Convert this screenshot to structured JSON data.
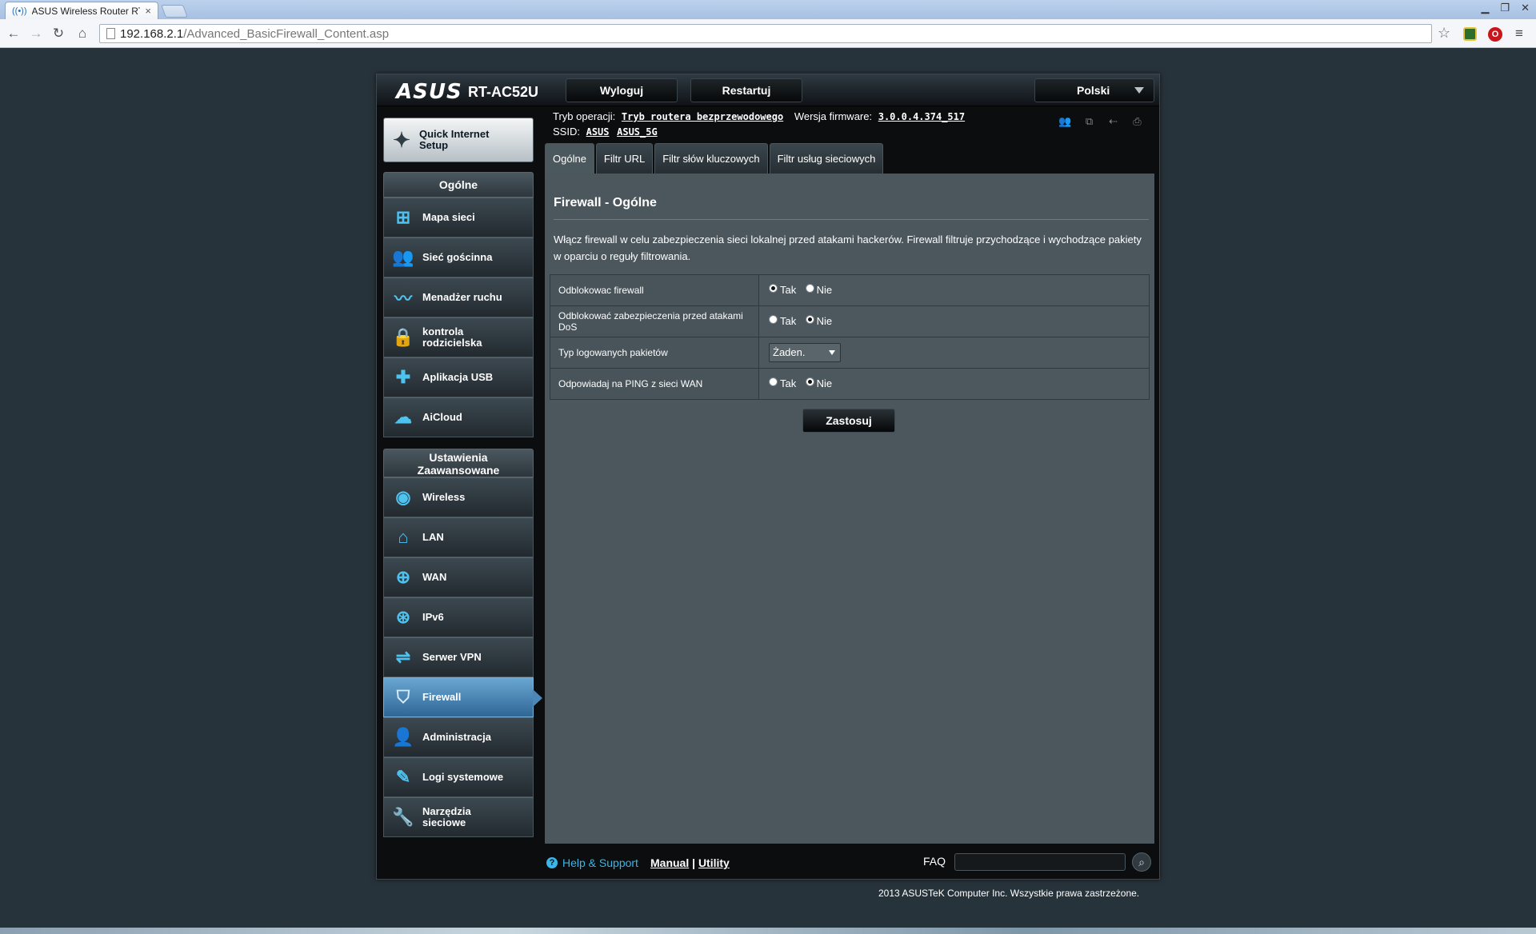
{
  "browser": {
    "tab_title": "ASUS Wireless Router RT-",
    "tab_close": "×",
    "url_host": "192.168.2.1",
    "url_path": "/Advanced_BasicFirewall_Content.asp"
  },
  "header": {
    "logo": "ASUS",
    "model": "RT-AC52U",
    "logout_label": "Wyloguj",
    "restart_label": "Restartuj",
    "language": "Polski"
  },
  "status": {
    "mode_label": "Tryb operacji:",
    "mode_value": "Tryb routera bezprzewodowego",
    "firmware_label": "Wersja firmware:",
    "firmware_value": "3.0.0.4.374_517",
    "ssid_label": "SSID:",
    "ssid_1": "ASUS",
    "ssid_2": "ASUS_5G"
  },
  "sidebar": {
    "quick_setup": "Quick Internet Setup",
    "general_title": "Ogólne",
    "general_items": [
      {
        "label": "Mapa sieci",
        "icon": "network-map-icon"
      },
      {
        "label": "Sieć gościnna",
        "icon": "guest-network-icon"
      },
      {
        "label": "Menadżer ruchu",
        "icon": "traffic-manager-icon"
      },
      {
        "label": "kontrola rodzicielska",
        "icon": "lock-icon"
      },
      {
        "label": "Aplikacja USB",
        "icon": "puzzle-icon"
      },
      {
        "label": "AiCloud",
        "icon": "cloud-icon"
      }
    ],
    "advanced_title": "Ustawienia Zaawansowane",
    "advanced_items": [
      {
        "label": "Wireless",
        "icon": "wifi-icon"
      },
      {
        "label": "LAN",
        "icon": "home-icon"
      },
      {
        "label": "WAN",
        "icon": "globe-icon"
      },
      {
        "label": "IPv6",
        "icon": "ipv6-globe-icon"
      },
      {
        "label": "Serwer VPN",
        "icon": "vpn-icon"
      },
      {
        "label": "Firewall",
        "icon": "shield-icon",
        "active": true
      },
      {
        "label": "Administracja",
        "icon": "admin-user-icon"
      },
      {
        "label": "Logi systemowe",
        "icon": "log-edit-icon"
      },
      {
        "label": "Narzędzia sieciowe",
        "icon": "wrench-icon"
      }
    ]
  },
  "tabs": [
    "Ogólne",
    "Filtr URL",
    "Filtr słów kluczowych",
    "Filtr usług sieciowych"
  ],
  "main": {
    "title": "Firewall - Ogólne",
    "description": "Włącz firewall w celu zabezpieczenia sieci lokalnej przed atakami hackerów. Firewall filtruje przychodzące i wychodzące pakiety w oparciu o reguły filtrowania.",
    "rows": [
      {
        "label": "Odblokowac firewall",
        "yes": "Tak",
        "no": "Nie",
        "selected": "Tak"
      },
      {
        "label": "Odblokować zabezpieczenia przed atakami DoS",
        "yes": "Tak",
        "no": "Nie",
        "selected": "Nie"
      },
      {
        "label": "Typ logowanych pakietów",
        "select_value": "Żaden."
      },
      {
        "label": "Odpowiadaj na PING z sieci WAN",
        "yes": "Tak",
        "no": "Nie",
        "selected": "Nie"
      }
    ],
    "apply_label": "Zastosuj"
  },
  "footer": {
    "help": "Help & Support",
    "manual": "Manual",
    "separator": "|",
    "utility": "Utility",
    "faq": "FAQ",
    "copyright": "2013 ASUSTeK Computer Inc. Wszystkie prawa zastrzeżone."
  }
}
